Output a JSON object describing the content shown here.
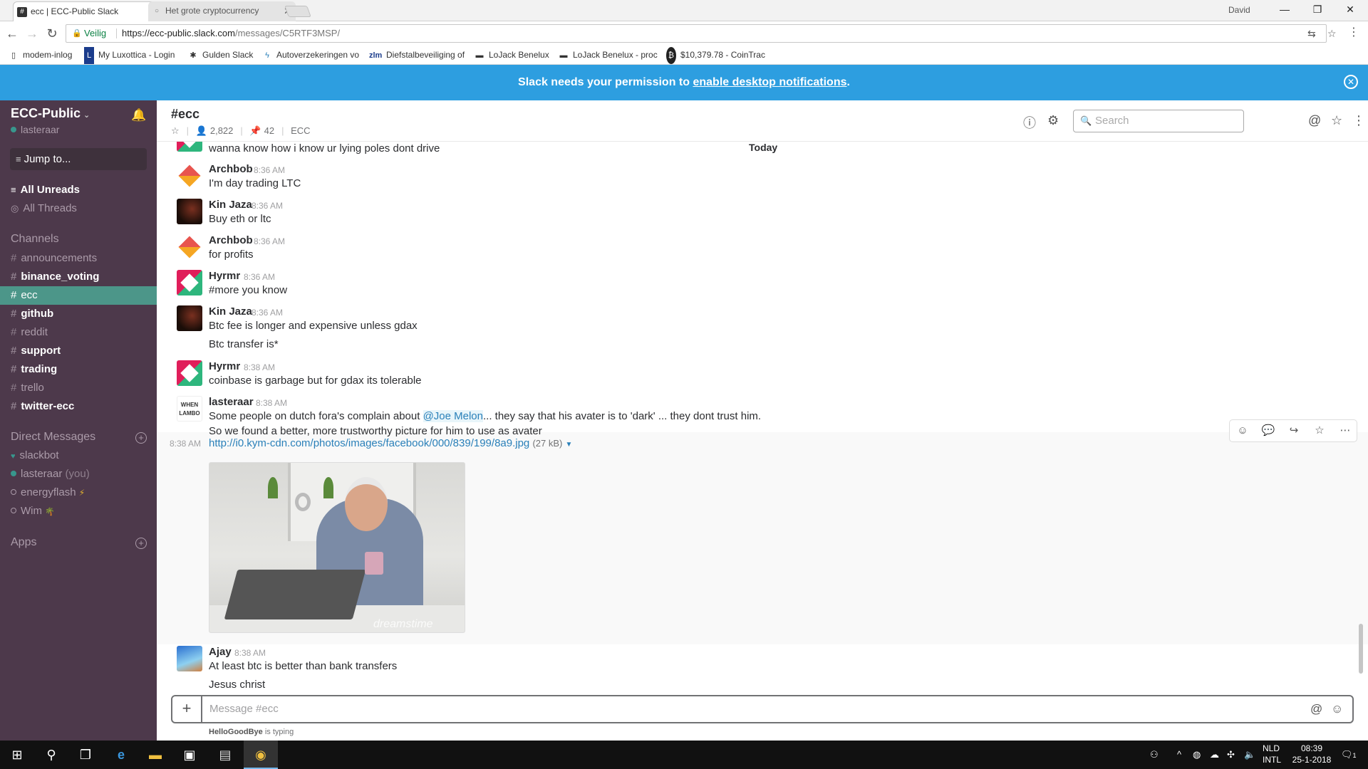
{
  "browser": {
    "tabs": [
      {
        "title": "ecc | ECC-Public Slack",
        "favicon": "#"
      },
      {
        "title": "Het grote cryptocurrency",
        "favicon": "○"
      }
    ],
    "user": "David",
    "secure_label": "Veilig",
    "url_host": "https://ecc-public.slack.com",
    "url_path": "/messages/C5RTF3MSP/",
    "bookmarks": [
      {
        "label": "modem-inlog",
        "icon": "page-icon"
      },
      {
        "label": "My Luxottica - Login",
        "icon": "lux-icon"
      },
      {
        "label": "Gulden Slack",
        "icon": "slack-icon"
      },
      {
        "label": "Autoverzekeringen vo",
        "icon": "bolt-icon"
      },
      {
        "label": "Diefstalbeveiliging of",
        "icon": "zlm-icon"
      },
      {
        "label": "LoJack Benelux",
        "icon": "lojack-icon"
      },
      {
        "label": "LoJack Benelux - proc",
        "icon": "lojack-icon"
      },
      {
        "label": "$10,379.78 - CoinTrac",
        "icon": "bitcoin-icon"
      }
    ]
  },
  "banner": {
    "text_before": "Slack needs your permission to ",
    "link": "enable desktop notifications",
    "text_after": "."
  },
  "sidebar": {
    "team": "ECC-Public",
    "user": "lasteraar",
    "jump": "Jump to...",
    "all_unreads": "All Unreads",
    "all_threads": "All Threads",
    "channels_header": "Channels",
    "channels": [
      {
        "name": "announcements",
        "bold": false,
        "selected": false
      },
      {
        "name": "binance_voting",
        "bold": true,
        "selected": false
      },
      {
        "name": "ecc",
        "bold": false,
        "selected": true
      },
      {
        "name": "github",
        "bold": true,
        "selected": false
      },
      {
        "name": "reddit",
        "bold": false,
        "selected": false
      },
      {
        "name": "support",
        "bold": true,
        "selected": false
      },
      {
        "name": "trading",
        "bold": true,
        "selected": false
      },
      {
        "name": "trello",
        "bold": false,
        "selected": false
      },
      {
        "name": "twitter-ecc",
        "bold": true,
        "selected": false
      }
    ],
    "dm_header": "Direct Messages",
    "dms": [
      {
        "name": "slackbot",
        "status": "bot",
        "suffix": ""
      },
      {
        "name": "lasteraar",
        "status": "online",
        "suffix": "(you)"
      },
      {
        "name": "energyflash",
        "status": "away",
        "suffix": "⚡"
      },
      {
        "name": "Wim",
        "status": "away",
        "suffix": "🌴"
      }
    ],
    "apps_header": "Apps"
  },
  "channel": {
    "title": "#ecc",
    "members": "2,822",
    "pins": "42",
    "topic": "ECC",
    "search_placeholder": "Search",
    "divider": "Today"
  },
  "messages": {
    "m0": {
      "text": "wanna know how i know ur lying poles dont drive"
    },
    "m1": {
      "sender": "Archbob",
      "time": "8:36 AM",
      "text": "I'm day trading LTC"
    },
    "m2": {
      "sender": "Kin Jaza",
      "time": "8:36 AM",
      "text": "Buy eth or ltc"
    },
    "m3": {
      "sender": "Archbob",
      "time": "8:36 AM",
      "text": "for profits"
    },
    "m4": {
      "sender": "Hyrmr",
      "time": "8:36 AM",
      "text": "#more you know"
    },
    "m5": {
      "sender": "Kin Jaza",
      "time": "8:36 AM",
      "text": "Btc fee is longer and expensive unless gdax",
      "text2": "Btc transfer is*"
    },
    "m6": {
      "sender": "Hyrmr",
      "time": "8:38 AM",
      "text": "coinbase is garbage but for gdax its tolerable"
    },
    "m7": {
      "sender": "lasteraar",
      "time": "8:38 AM",
      "text_a": "Some people on dutch fora's complain about ",
      "mention": "@Joe Melon",
      "text_b": "... they say that his avater is to 'dark' ... they dont trust him.",
      "text2": "So we found a better, more trustworthy picture for him to use as avater",
      "avatar_text": "WHEN LAMBO"
    },
    "m8": {
      "time": "8:38 AM",
      "link": "http://i0.kym-cdn.com/photos/images/facebook/000/839/199/8a9.jpg",
      "size": "(27 kB)",
      "watermark": "dreamstime"
    },
    "m9": {
      "sender": "Ajay",
      "time": "8:38 AM",
      "text": "At least btc is better than bank transfers",
      "text2": "Jesus christ"
    }
  },
  "composer": {
    "placeholder": "Message #ecc",
    "typing_user": "HelloGoodBye",
    "typing_suffix": " is typing"
  },
  "taskbar": {
    "lang1": "NLD",
    "lang2": "INTL",
    "time": "08:39",
    "date": "25-1-2018",
    "notif": "1"
  },
  "colors": {
    "sidebar": "#4d394b",
    "selected": "#4c9689",
    "banner": "#2d9ee0",
    "link": "#2a80b9"
  }
}
